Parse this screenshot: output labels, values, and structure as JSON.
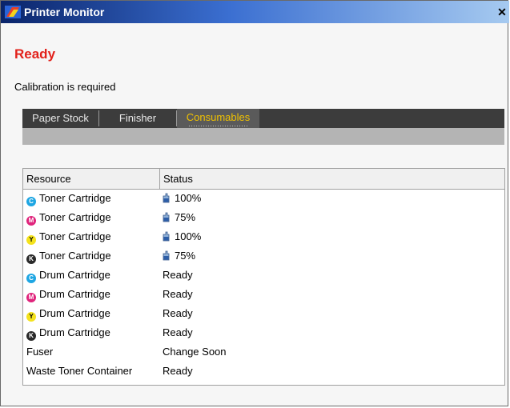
{
  "window": {
    "title": "Printer Monitor",
    "close_glyph": "✕"
  },
  "status": {
    "title": "Ready",
    "message": "Calibration is required",
    "title_color": "#e2211b"
  },
  "tabs": [
    {
      "label": "Paper Stock",
      "active": false
    },
    {
      "label": "Finisher",
      "active": false
    },
    {
      "label": "Consumables",
      "active": true
    }
  ],
  "table": {
    "headers": [
      "Resource",
      "Status"
    ],
    "rows": [
      {
        "resource": "Toner Cartridge",
        "status": "100%",
        "icon": "cyan-dot-icon",
        "color": "#1ea6e3",
        "letter": "C",
        "toner": true
      },
      {
        "resource": "Toner Cartridge",
        "status": "75%",
        "icon": "magenta-dot-icon",
        "color": "#e0247c",
        "letter": "M",
        "toner": true
      },
      {
        "resource": "Toner Cartridge",
        "status": "100%",
        "icon": "yellow-dot-icon",
        "color": "#f4e21c",
        "letter": "Y",
        "toner": true
      },
      {
        "resource": "Toner Cartridge",
        "status": "75%",
        "icon": "black-dot-icon",
        "color": "#2a2a2a",
        "letter": "K",
        "toner": true
      },
      {
        "resource": "Drum Cartridge",
        "status": "Ready",
        "icon": "cyan-dot-icon",
        "color": "#1ea6e3",
        "letter": "C",
        "toner": false
      },
      {
        "resource": "Drum Cartridge",
        "status": "Ready",
        "icon": "magenta-dot-icon",
        "color": "#e0247c",
        "letter": "M",
        "toner": false
      },
      {
        "resource": "Drum Cartridge",
        "status": "Ready",
        "icon": "yellow-dot-icon",
        "color": "#f4e21c",
        "letter": "Y",
        "toner": false
      },
      {
        "resource": "Drum Cartridge",
        "status": "Ready",
        "icon": "black-dot-icon",
        "color": "#2a2a2a",
        "letter": "K",
        "toner": false
      },
      {
        "resource": "Fuser",
        "status": "Change Soon",
        "icon": "",
        "color": "",
        "letter": "",
        "toner": false
      },
      {
        "resource": "Waste Toner Container",
        "status": "Ready",
        "icon": "",
        "color": "",
        "letter": "",
        "toner": false
      }
    ]
  }
}
